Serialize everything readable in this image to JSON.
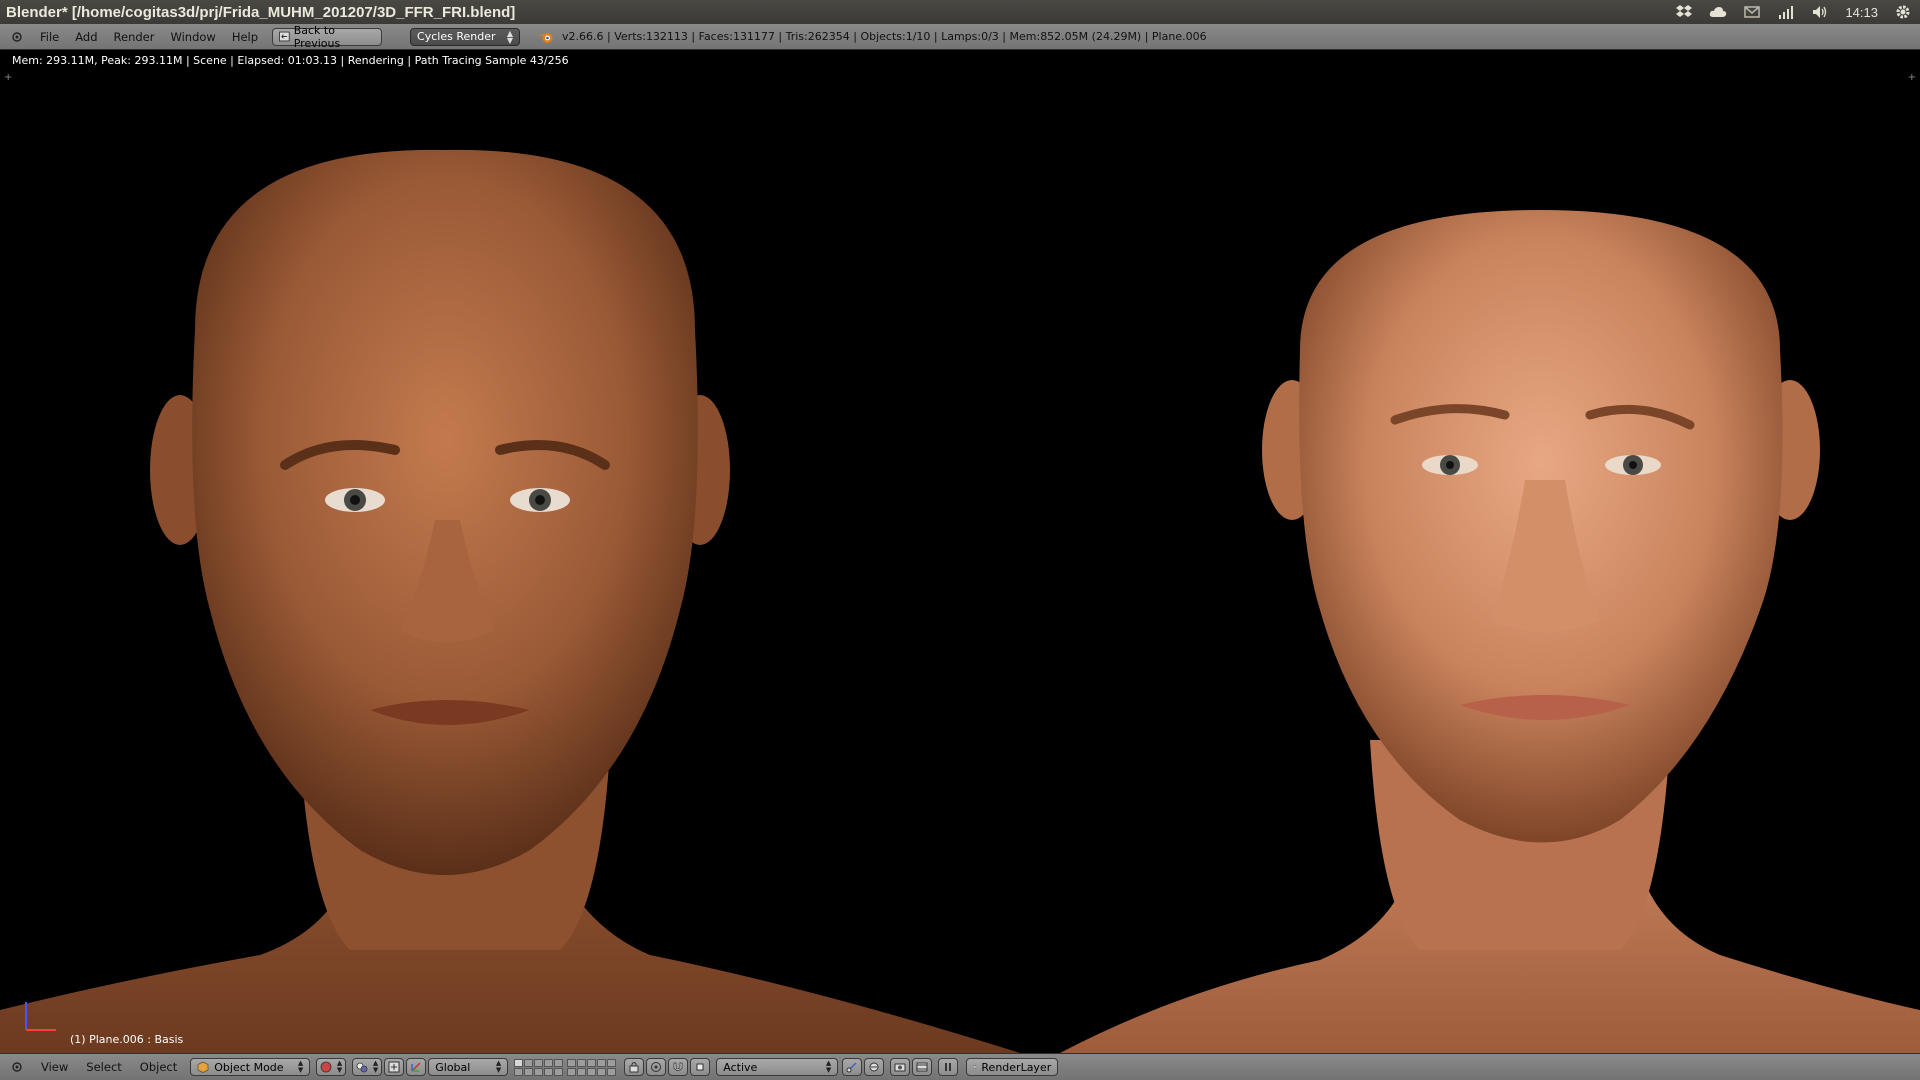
{
  "os_bar": {
    "window_title": "Blender* [/home/cogitas3d/prj/Frida_MUHM_201207/3D_FFR_FRI.blend]",
    "clock": "14:13",
    "tray_icons": [
      "dropbox-icon",
      "cloud-icon",
      "mail-icon",
      "network-icon",
      "volume-icon",
      "settings-gear-icon"
    ]
  },
  "header": {
    "menu": [
      "File",
      "Add",
      "Render",
      "Window",
      "Help"
    ],
    "back_button": "Back to Previous",
    "engine": "Cycles Render",
    "stats": "v2.66.6 | Verts:132113 | Faces:131177 | Tris:262354 | Objects:1/10 | Lamps:0/3 | Mem:852.05M (24.29M) | Plane.006"
  },
  "viewport": {
    "render_info": "Mem: 293.11M, Peak: 293.11M | Scene | Elapsed: 01:03.13 | Rendering | Path Tracing Sample 43/256",
    "object_label": "(1) Plane.006 : Basis"
  },
  "bottom_bar": {
    "menu": [
      "View",
      "Select",
      "Object"
    ],
    "mode": "Object Mode",
    "orientation": "Global",
    "pivot": "Active",
    "render_layer": "RenderLayer"
  },
  "colors": {
    "background": "#000000",
    "skin_left": "#9a5a36",
    "skin_right": "#c9835c"
  }
}
